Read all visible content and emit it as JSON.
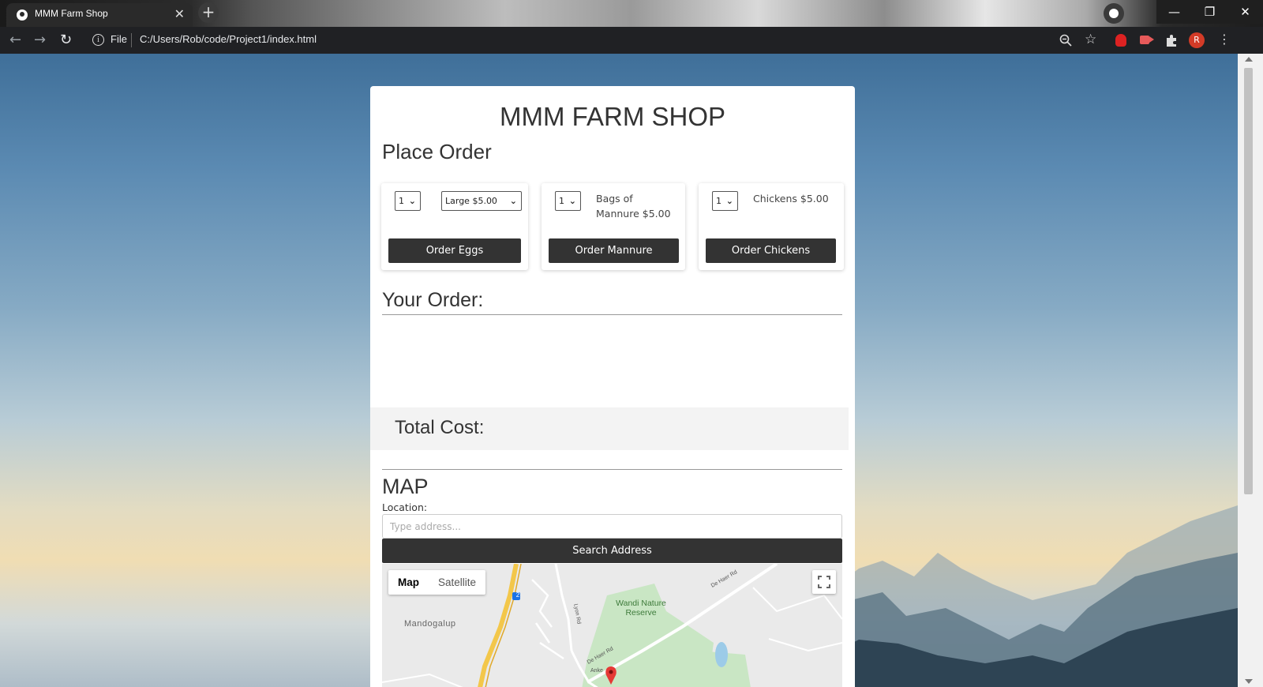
{
  "browser": {
    "tab_title": "MMM Farm Shop",
    "tab_close": "✕",
    "new_tab": "+",
    "file_label": "File",
    "url": "C:/Users/Rob/code/Project1/index.html",
    "avatar_initial": "R"
  },
  "shop": {
    "title": "MMM FARM SHOP",
    "place_order": "Place Order",
    "eggs": {
      "qty": "1",
      "size": "Large $5.00",
      "button": "Order Eggs"
    },
    "manure": {
      "qty": "1",
      "label": "Bags of Mannure $5.00",
      "button": "Order Mannure"
    },
    "chickens": {
      "qty": "1",
      "label": "Chickens $5.00",
      "button": "Order Chickens"
    },
    "your_order": "Your Order:",
    "total_cost": "Total Cost:"
  },
  "map_section": {
    "heading": "MAP",
    "location_label": "Location:",
    "placeholder": "Type address...",
    "search_button": "Search Address",
    "type_map": "Map",
    "type_satellite": "Satellite",
    "labels": {
      "reserve": "Wandi Nature Reserve",
      "town": "Mandogalup",
      "road1": "De Haer Rd",
      "road2": "De Haer Rd",
      "road3": "Lyon Rd",
      "road4": "Anke",
      "highway": "2"
    }
  }
}
